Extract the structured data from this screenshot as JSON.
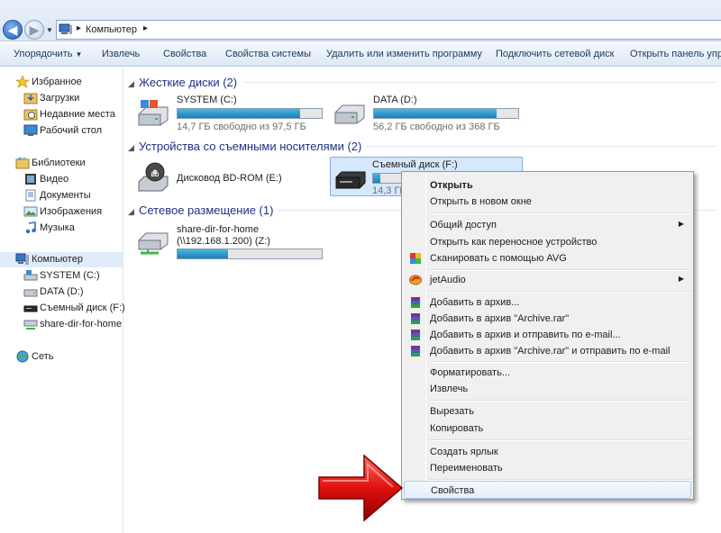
{
  "address": {
    "crumb": "Компьютер"
  },
  "toolbar": {
    "organize": "Упорядочить",
    "eject": "Извлечь",
    "properties": "Свойства",
    "system_properties": "Свойства системы",
    "uninstall": "Удалить или изменить программу",
    "map_drive": "Подключить сетевой диск",
    "control_panel": "Открыть панель упра"
  },
  "nav": {
    "favorites": "Избранное",
    "downloads": "Загрузки",
    "recent": "Недавние места",
    "desktop": "Рабочий стол",
    "libraries": "Библиотеки",
    "video": "Видео",
    "documents": "Документы",
    "images": "Изображения",
    "music": "Музыка",
    "computer": "Компьютер",
    "system_c": "SYSTEM (C:)",
    "data_d": "DATA (D:)",
    "removable_f": "Съемный диск (F:)",
    "share": "share-dir-for-home",
    "network": "Сеть"
  },
  "groups": {
    "hdd": "Жесткие диски (2)",
    "removable": "Устройства со съемными носителями (2)",
    "network": "Сетевое размещение (1)"
  },
  "drives": {
    "system": {
      "name": "SYSTEM (C:)",
      "free": "14,7 ГБ свободно из 97,5 ГБ",
      "used_fraction": 0.85
    },
    "data": {
      "name": "DATA (D:)",
      "free": "56,2 ГБ свободно из 368 ГБ",
      "used_fraction": 0.85
    },
    "bdrom": {
      "name": "Дисковод BD-ROM (E:)"
    },
    "removable": {
      "name": "Съемный диск (F:)",
      "free": "14,3 ГБ",
      "used_fraction": 0.05
    },
    "share": {
      "name": "share-dir-for-home",
      "path": "(\\\\192.168.1.200) (Z:)",
      "used_fraction": 0.35
    }
  },
  "menu": {
    "open": "Открыть",
    "open_new": "Открыть в новом окне",
    "share": "Общий доступ",
    "portable": "Открыть как переносное устройство",
    "avg": "Сканировать с помощью AVG",
    "jetaudio": "jetAudio",
    "add_archive": "Добавить в архив...",
    "add_rar": "Добавить в архив \"Archive.rar\"",
    "add_email": "Добавить в архив и отправить по e-mail...",
    "add_rar_email": "Добавить в архив \"Archive.rar\" и отправить по e-mail",
    "format": "Форматировать...",
    "eject": "Извлечь",
    "cut": "Вырезать",
    "copy": "Копировать",
    "shortcut": "Создать ярлык",
    "rename": "Переименовать",
    "properties": "Свойства"
  }
}
